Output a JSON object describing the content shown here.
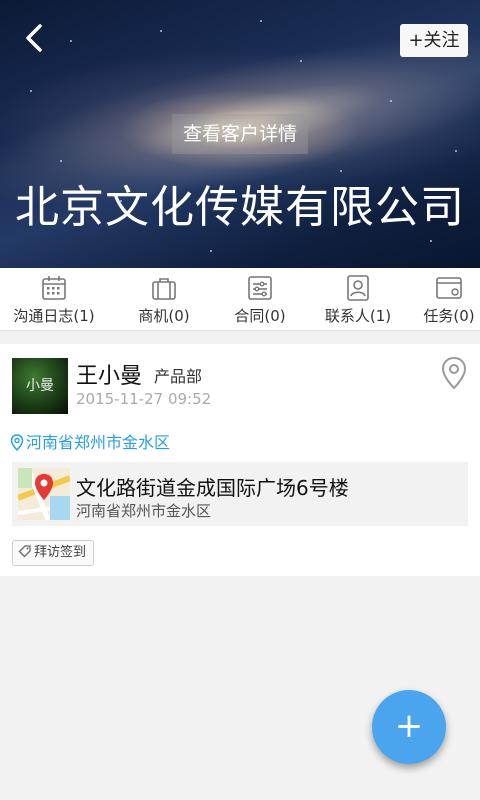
{
  "header": {
    "follow_label": "+关注",
    "detail_label": "查看客户详情",
    "company_name": "北京文化传媒有限公司"
  },
  "tabs": [
    {
      "label": "沟通日志(1)",
      "icon": "calendar-icon"
    },
    {
      "label": "商机(0)",
      "icon": "briefcase-icon"
    },
    {
      "label": "合同(0)",
      "icon": "contract-icon"
    },
    {
      "label": "联系人(1)",
      "icon": "contact-card-icon"
    },
    {
      "label": "任务(0)",
      "icon": "task-icon"
    }
  ],
  "log_card": {
    "avatar_text": "小曼",
    "name": "王小曼",
    "department": "产品部",
    "time": "2015-11-27 09:52",
    "location": "河南省郑州市金水区",
    "address": {
      "title": "文化路街道金成国际广场6号楼",
      "subtitle": "河南省郑州市金水区"
    },
    "tag": "拜访签到"
  },
  "fab": {
    "label": "+"
  },
  "colors": {
    "accent": "#4aa4ee",
    "location_text": "#2a9fe0"
  }
}
